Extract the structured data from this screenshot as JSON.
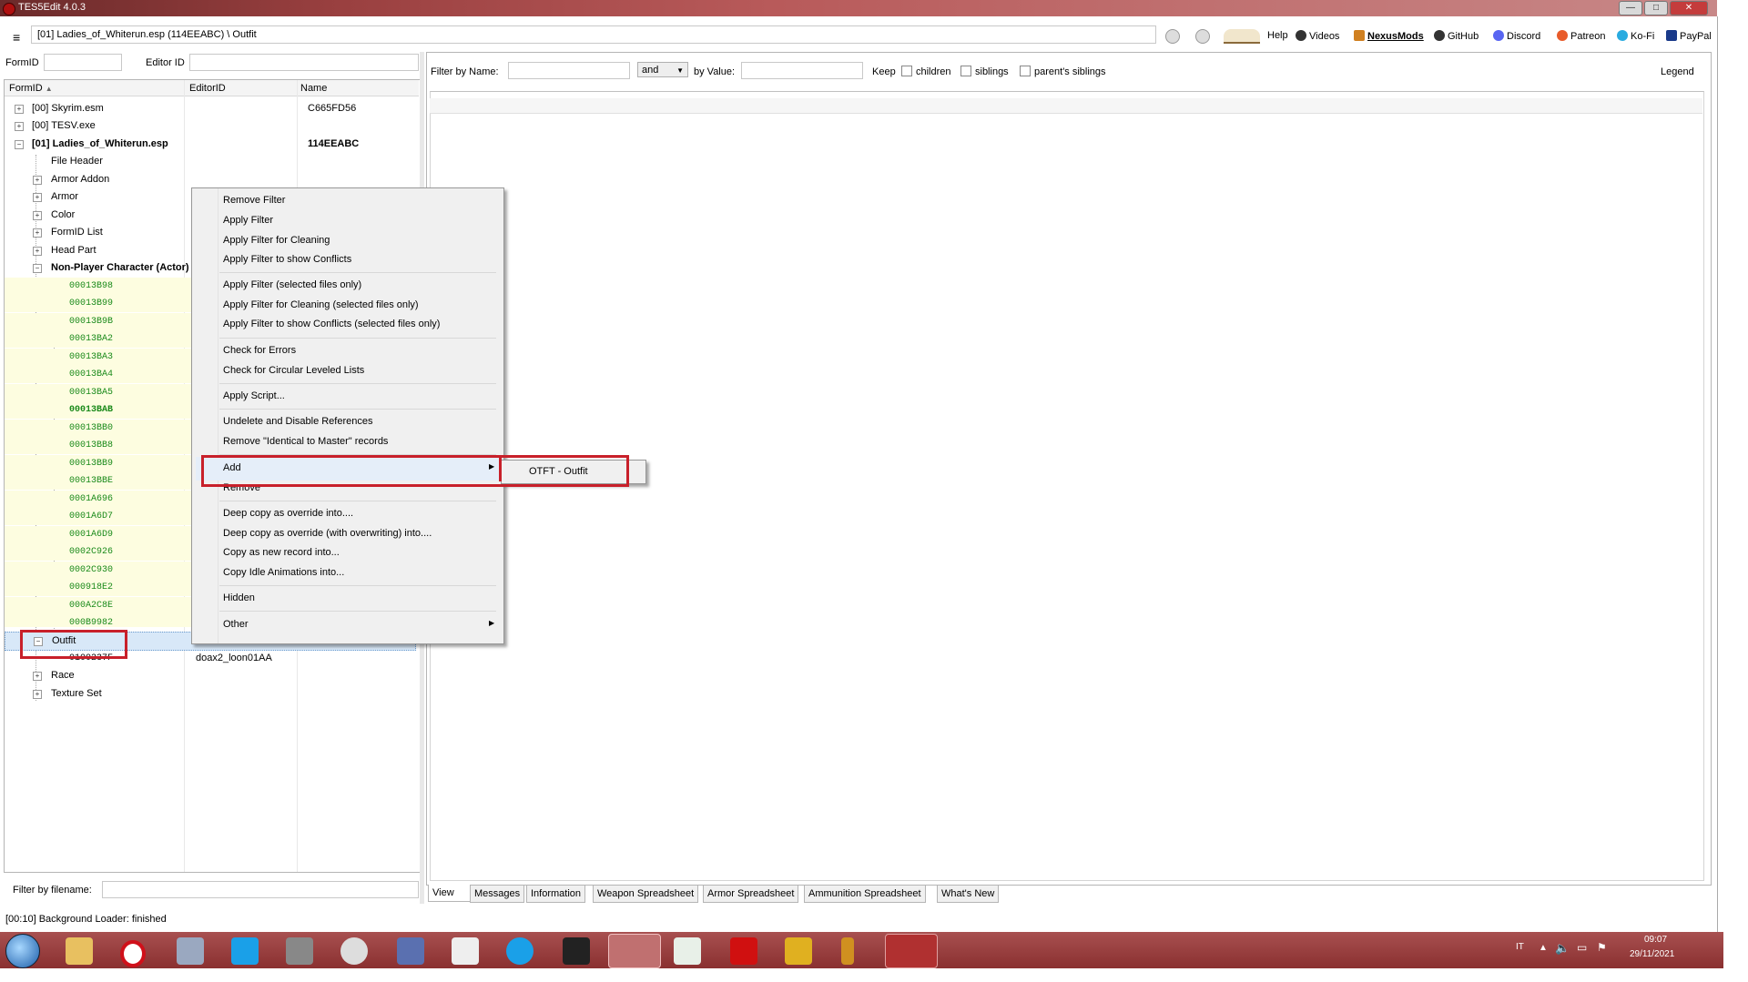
{
  "window": {
    "title": "TES5Edit 4.0.3",
    "buttons": {
      "minimize": "—",
      "maximize": "□",
      "close": "✕"
    }
  },
  "topbar": {
    "path": "[01] Ladies_of_Whiterun.esp (114EEABC) \\ Outfit",
    "links": [
      {
        "label": "Help",
        "icon": "book-icon",
        "color": "#8a6a3a"
      },
      {
        "label": "Videos",
        "icon": "videos-icon",
        "color": "#333333"
      },
      {
        "label": "NexusMods",
        "icon": "nexus-icon",
        "color": "#d08020"
      },
      {
        "label": "GitHub",
        "icon": "github-icon",
        "color": "#333333"
      },
      {
        "label": "Discord",
        "icon": "discord-icon",
        "color": "#5865f2"
      },
      {
        "label": "Patreon",
        "icon": "patreon-icon",
        "color": "#e85b2a"
      },
      {
        "label": "Ko-Fi",
        "icon": "kofi-icon",
        "color": "#29abe0"
      },
      {
        "label": "PayPal",
        "icon": "paypal-icon",
        "color": "#1a3a8a"
      }
    ]
  },
  "left": {
    "formid_label": "FormID",
    "editorid_label": "Editor ID",
    "columns": [
      "FormID",
      "EditorID",
      "Name"
    ],
    "filter_filename_label": "Filter by filename:"
  },
  "tree": [
    {
      "label": "[00] Skyrim.esm",
      "name": "C665FD56"
    },
    {
      "label": "[00] TESV.exe",
      "name": ""
    },
    {
      "label": "[01] Ladies_of_Whiterun.esp",
      "name": "114EEABC"
    },
    {
      "label": "File Header"
    },
    {
      "label": "Armor Addon"
    },
    {
      "label": "Armor"
    },
    {
      "label": "Color"
    },
    {
      "label": "FormID List"
    },
    {
      "label": "Head Part"
    },
    {
      "label": "Non-Player Character (Actor)"
    },
    {
      "label": "00013B98"
    },
    {
      "label": "00013B99"
    },
    {
      "label": "00013B9B"
    },
    {
      "label": "00013BA2"
    },
    {
      "label": "00013BA3"
    },
    {
      "label": "00013BA4"
    },
    {
      "label": "00013BA5"
    },
    {
      "label": "00013BAB"
    },
    {
      "label": "00013BB0"
    },
    {
      "label": "00013BB8"
    },
    {
      "label": "00013BB9"
    },
    {
      "label": "00013BBE"
    },
    {
      "label": "0001A696"
    },
    {
      "label": "0001A6D7"
    },
    {
      "label": "0001A6D9"
    },
    {
      "label": "0002C926"
    },
    {
      "label": "0002C930"
    },
    {
      "label": "000918E2"
    },
    {
      "label": "000A2C8E"
    },
    {
      "label": "000B9982"
    },
    {
      "label": "Outfit"
    },
    {
      "label": "0100237F",
      "editorid": "doax2_loon01AA"
    },
    {
      "label": "Race"
    },
    {
      "label": "Texture Set"
    }
  ],
  "right": {
    "filter_name_label": "Filter by Name:",
    "and_value": "and",
    "by_value_label": "by Value:",
    "keep_label": "Keep",
    "children_label": "children",
    "siblings_label": "siblings",
    "parents_siblings_label": "parent's siblings",
    "legend_label": "Legend",
    "tabs": [
      "View",
      "Messages",
      "Information",
      "Weapon Spreadsheet",
      "Armor Spreadsheet",
      "Ammunition Spreadsheet",
      "What's New"
    ]
  },
  "status": "[00:10] Background Loader: finished",
  "context_menu": {
    "items": [
      "Remove Filter",
      "Apply Filter",
      "Apply Filter for Cleaning",
      "Apply Filter to show Conflicts",
      "Apply Filter (selected files only)",
      "Apply Filter for Cleaning (selected files only)",
      "Apply Filter to show Conflicts (selected files only)",
      "Check for Errors",
      "Check for Circular Leveled Lists",
      "Apply Script...",
      "Undelete and Disable References",
      "Remove \"Identical to Master\" records",
      "Add",
      "Remove",
      "Deep copy as override into....",
      "Deep copy as override (with overwriting) into....",
      "Copy as new record into...",
      "Copy Idle Animations into...",
      "Hidden",
      "Other"
    ],
    "submenu_item": "OTFT - Outfit"
  },
  "taskbar": {
    "lang": "IT",
    "time": "09:07",
    "date": "29/11/2021"
  }
}
